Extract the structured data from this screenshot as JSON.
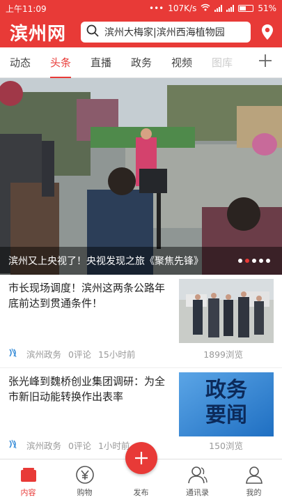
{
  "statusbar": {
    "time": "上午11:09",
    "speed": "107K/s",
    "battery": "51%"
  },
  "header": {
    "logo": "滨州网",
    "search_text": "滨州大梅家|滨州西海植物园"
  },
  "tabs": [
    {
      "label": "动态"
    },
    {
      "label": "头条"
    },
    {
      "label": "直播"
    },
    {
      "label": "政务"
    },
    {
      "label": "视频"
    },
    {
      "label": "图库"
    }
  ],
  "banner": {
    "caption": "滨州又上央视了！央视发现之旅《聚焦先锋》"
  },
  "news": [
    {
      "title": "市长现场调度！滨州这两条公路年底前达到贯通条件！",
      "source": "滨州政务",
      "comments": "0评论",
      "time": "15小时前",
      "views": "1899浏览"
    },
    {
      "title": "张光峰到魏桥创业集团调研：为全市新旧动能转换作出表率",
      "source": "滨州政务",
      "comments": "0评论",
      "time": "1小时前",
      "views": "150浏览",
      "thumb_text": [
        "政务",
        "要闻"
      ]
    }
  ],
  "bottomnav": [
    {
      "label": "内容"
    },
    {
      "label": "购物"
    },
    {
      "label": "发布"
    },
    {
      "label": "通讯录"
    },
    {
      "label": "我的"
    }
  ],
  "colors": {
    "accent": "#e83a37"
  }
}
